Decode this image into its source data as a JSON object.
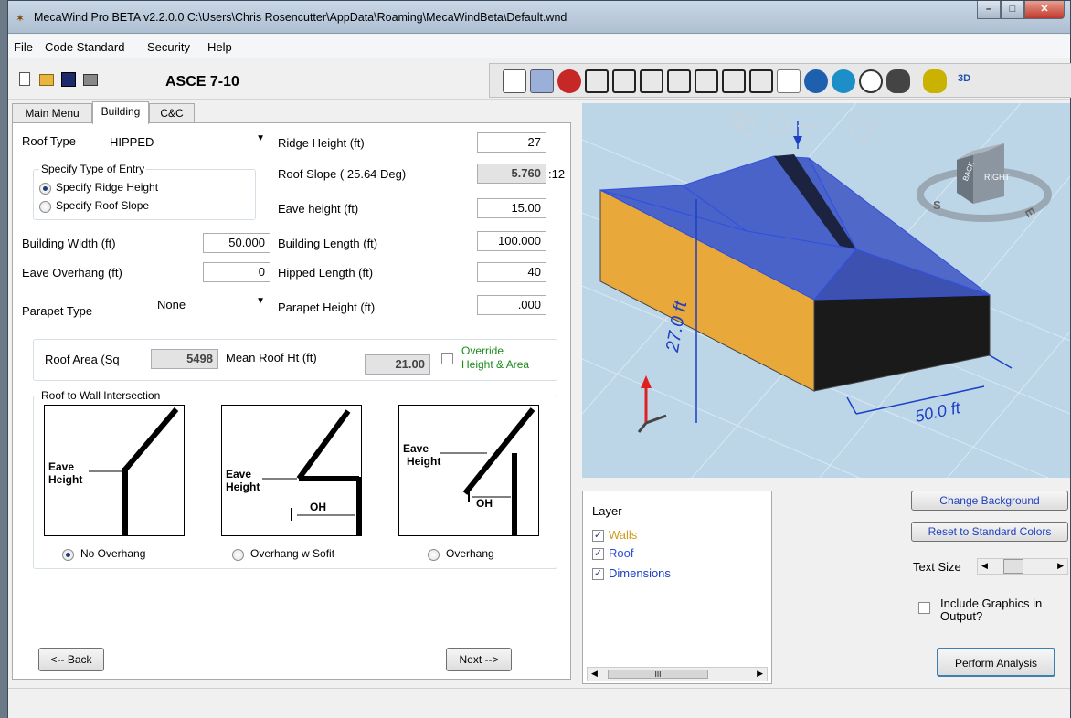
{
  "window": {
    "title": "MecaWind Pro BETA v2.2.0.0 C:\\Users\\Chris Rosencutter\\AppData\\Roaming\\MecaWindBeta\\Default.wnd"
  },
  "menu": {
    "items": [
      "File",
      "Code Standard",
      "Security",
      "Help"
    ]
  },
  "toolbar": {
    "code_standard": "ASCE 7-10",
    "toggle_3d_label": "3D"
  },
  "tabs": [
    "Main Menu",
    "Building",
    "C&C"
  ],
  "building": {
    "roof_type_label": "Roof Type",
    "roof_type_value": "HIPPED",
    "entry_group_title": "Specify Type of Entry",
    "entry_opt_ridge": "Specify Ridge Height",
    "entry_opt_slope": "Specify Roof Slope",
    "building_width_label": "Building Width (ft)",
    "building_width_value": "50.000",
    "eave_overhang_label": "Eave Overhang (ft)",
    "eave_overhang_value": "0",
    "parapet_type_label": "Parapet Type",
    "parapet_type_value": "None",
    "ridge_height_label": "Ridge Height (ft)",
    "ridge_height_value": "27",
    "roof_slope_label": "Roof Slope ( 25.64 Deg)",
    "roof_slope_value": "5.760",
    "roof_slope_suffix": ":12",
    "eave_height_label": "Eave height (ft)",
    "eave_height_value": "15.00",
    "building_length_label": "Building Length (ft)",
    "building_length_value": "100.000",
    "hipped_length_label": "Hipped Length (ft)",
    "hipped_length_value": "40",
    "parapet_height_label": "Parapet Height (ft)",
    "parapet_height_value": ".000",
    "roof_area_label": "Roof Area (Sq",
    "roof_area_value": "5498",
    "mean_roof_ht_label": "Mean Roof Ht (ft)",
    "mean_roof_ht_value": "21.00",
    "override_line1": "Override",
    "override_line2": "Height & Area",
    "intersection_title": "Roof to Wall Intersection",
    "diag_eave": "Eave",
    "diag_height": "Height",
    "diag_oh": "OH",
    "opt_no_overhang": "No Overhang",
    "opt_overhang_soffit": "Overhang w Sofit",
    "opt_overhang": "Overhang",
    "back_button": "<-- Back",
    "next_button": "Next -->"
  },
  "view3d": {
    "dim_height": "27.0 ft",
    "dim_width": "50.0 ft",
    "cube_right": "RIGHT",
    "cube_back": "BACK",
    "compass_s": "S",
    "compass_e": "E"
  },
  "layers": {
    "title": "Layer",
    "items": [
      {
        "label": "Walls",
        "color": "#d29a1e"
      },
      {
        "label": "Roof",
        "color": "#2b4fd8"
      },
      {
        "label": "Dimensions",
        "color": "#1d3fc4"
      }
    ],
    "scroll_glyph": "III"
  },
  "right_panel": {
    "change_background": "Change Background",
    "reset_colors": "Reset to Standard Colors",
    "text_size_label": "Text Size",
    "include_line1": "Include Graphics in",
    "include_line2": "Output?",
    "perform_analysis": "Perform Analysis"
  },
  "colors": {
    "walls": "#e8a83a",
    "roof": "#4a63c8",
    "accent": "#2b4fd8",
    "override": "#1a8a1a"
  }
}
